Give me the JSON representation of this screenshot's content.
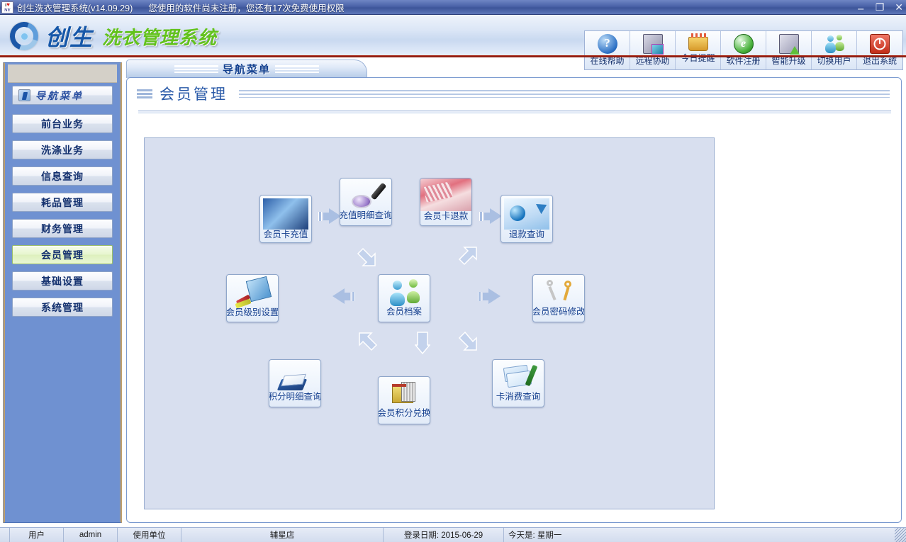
{
  "window": {
    "app_icon": "i-love-ny-icon",
    "title": "创生洗衣管理系统(v14.09.29)",
    "registration_warning": "您使用的软件尚未注册，您还有17次免费使用权限",
    "minimize": "−",
    "restore": "❐",
    "close": "✕"
  },
  "banner": {
    "logo_main": "创生",
    "logo_sub": "洗衣管理系统",
    "toolbar": [
      {
        "label": "在线帮助",
        "icon": "help-question-icon"
      },
      {
        "label": "远程协助",
        "icon": "remote-desktop-icon"
      },
      {
        "label": "今日提醒",
        "icon": "birthday-cake-icon"
      },
      {
        "label": "软件注册",
        "icon": "register-globe-icon"
      },
      {
        "label": "智能升级",
        "icon": "upgrade-computer-icon"
      },
      {
        "label": "切换用户",
        "icon": "switch-user-icon"
      },
      {
        "label": "退出系统",
        "icon": "power-exit-icon"
      }
    ]
  },
  "sidebar": {
    "header": {
      "label": "导航菜单",
      "icon": "nav-menu-icon"
    },
    "items": [
      {
        "label": "前台业务",
        "active": false
      },
      {
        "label": "洗涤业务",
        "active": false
      },
      {
        "label": "信息查询",
        "active": false
      },
      {
        "label": "耗品管理",
        "active": false
      },
      {
        "label": "财务管理",
        "active": false
      },
      {
        "label": "会员管理",
        "active": true
      },
      {
        "label": "基础设置",
        "active": false
      },
      {
        "label": "系统管理",
        "active": false
      }
    ]
  },
  "content": {
    "tab_label": "导航菜单",
    "panel_title": "会员管理",
    "tiles": [
      {
        "id": "member-card-recharge",
        "label": "会员卡充值",
        "icon": "card-machine-icon"
      },
      {
        "id": "recharge-detail-query",
        "label": "充值明细查询",
        "icon": "magnifier-icon"
      },
      {
        "id": "member-card-refund",
        "label": "会员卡退款",
        "icon": "cash-money-icon"
      },
      {
        "id": "refund-query",
        "label": "退款查询",
        "icon": "refund-arrow-icon"
      },
      {
        "id": "member-level-settings",
        "label": "会员级别设置",
        "icon": "settings-board-icon"
      },
      {
        "id": "member-archive",
        "label": "会员档案",
        "icon": "users-icon"
      },
      {
        "id": "member-password-change",
        "label": "会员密码修改",
        "icon": "keys-icon"
      },
      {
        "id": "points-detail-query",
        "label": "积分明细查询",
        "icon": "book-icon"
      },
      {
        "id": "member-points-exchange",
        "label": "会员积分兑换",
        "icon": "gift-cube-icon"
      },
      {
        "id": "card-consumption-query",
        "label": "卡消费查询",
        "icon": "cards-pen-icon"
      }
    ]
  },
  "statusbar": {
    "user_label": "用户",
    "user_value": "admin",
    "unit_label": "使用单位",
    "unit_value": "辅星店",
    "login_date": "登录日期: 2015-06-29",
    "weekday": "今天是: 星期一"
  },
  "colors": {
    "titlebar": "#4a62a8",
    "sidebar": "#6f91d1",
    "panel_bg": "#d8dfef",
    "accent_text": "#16408f",
    "active_item": "#e7f6cf",
    "banner_rule": "#8b1b10"
  }
}
